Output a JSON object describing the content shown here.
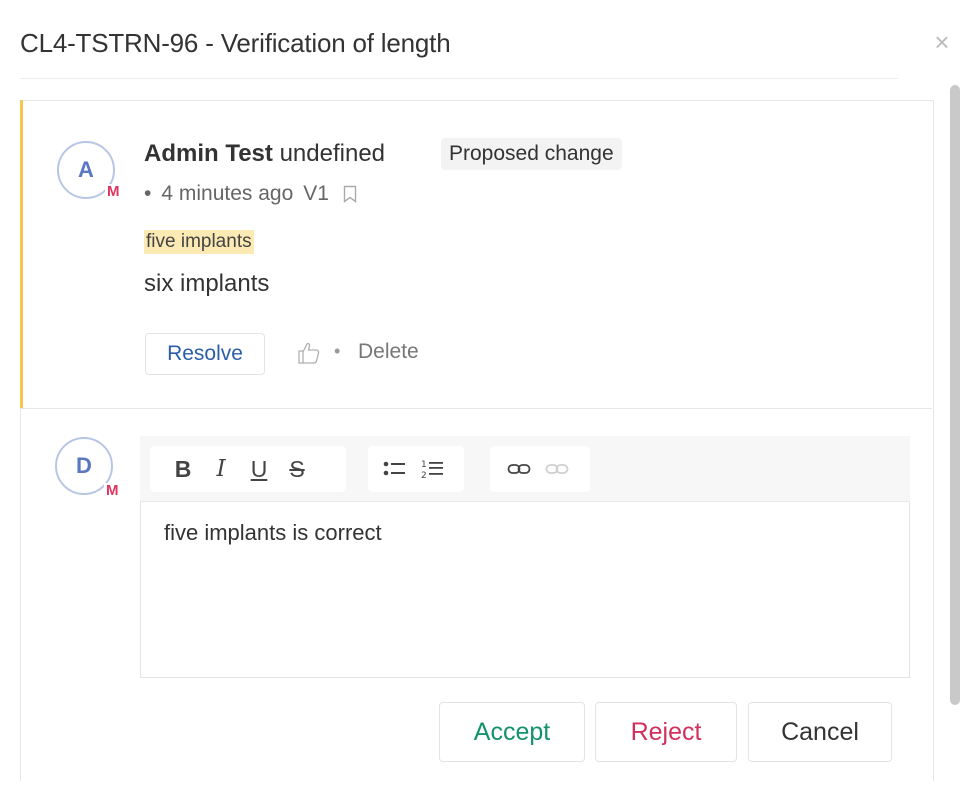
{
  "dialog": {
    "title": "CL4-TSTRN-96 - Verification of length",
    "close_icon": "close-icon",
    "close_glyph": "×"
  },
  "comment": {
    "avatar_initial": "A",
    "avatar_badge": "M",
    "author": "Admin Test",
    "author_suffix": "undefined",
    "status_tag": "Proposed change",
    "bullet": "•",
    "timestamp": "4 minutes ago",
    "version": "V1",
    "bookmark_icon": "bookmark-icon",
    "old_text": "five implants",
    "new_text": "six implants",
    "resolve_label": "Resolve",
    "like_icon": "thumbs-up-icon",
    "separator": "•",
    "delete_label": "Delete",
    "accent_color": "#f2c94c"
  },
  "reply": {
    "avatar_initial": "D",
    "avatar_badge": "M",
    "toolbar": {
      "bold": "B",
      "italic": "I",
      "underline": "U",
      "strike": "S",
      "bullet_list_icon": "bulleted-list-icon",
      "numbered_list_icon": "numbered-list-icon",
      "link_icon": "link-icon",
      "unlink_icon": "unlink-icon"
    },
    "text": "five implants is correct"
  },
  "actions": {
    "accept_label": "Accept",
    "reject_label": "Reject",
    "cancel_label": "Cancel",
    "accept_color": "#13936b",
    "reject_color": "#d2305c"
  }
}
